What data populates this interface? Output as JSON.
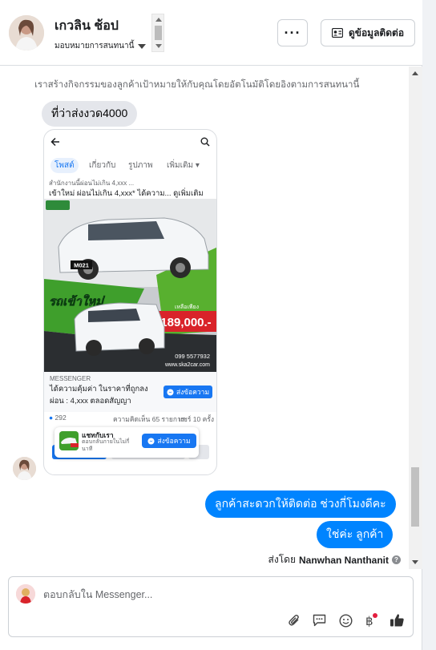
{
  "header": {
    "contact_name": "เกวลิน ช้อป",
    "assign_label": "มอบหมายการสนทนานี้",
    "more_label": "···",
    "contact_info_label": "ดูข้อมูลติดต่อ"
  },
  "conversation": {
    "system_note": "เราสร้างกิจกรรมของลูกค้าเป้าหมายให้กับคุณโดยอัตโนมัติโดยอิงตามการสนทนานี้",
    "incoming_message": "ที่ว่าส่งงวด4000",
    "outgoing_messages": [
      "ลูกค้าสะดวกให้ติดต่อ ช่วงกี่โมงดีคะ",
      "ใช่ค่ะ ลูกค้า"
    ],
    "sent_by_label": "ส่งโดย",
    "sent_by_name": "Nanwhan Nanthanit"
  },
  "ad_preview": {
    "tabs": [
      "โพสต์",
      "เกี่ยวกับ",
      "รูปภาพ",
      "เพิ่มเติม"
    ],
    "caption_top": "สำนักงานนี้ผ่อนไม่เกิน 4,xxx ...",
    "caption": "เข้าใหม่ ผ่อนไม่เกิน 4,xxx* ได้ความ... ดูเพิ่มเติม",
    "image_badge": "M021",
    "image_slogan": "รถเข้าใหม่",
    "price_label": "เหลือเพียง",
    "price": "189,000.-",
    "phone": "099 5577932",
    "website": "www.ska2car.com",
    "messenger_label": "MESSENGER",
    "messenger_text": "ได้ความคุ้มค่า ในราคาที่ถูกลง ผ่อน : 4,xxx ตลอดสัญญา",
    "send_button": "ส่งข้อความ",
    "reactions_count": "292",
    "comments": "ความคิดเห็น 65 รายการ",
    "shares": "แชร์ 10 ครั้ง",
    "popup_title": "แชทกับเรา",
    "popup_subtitle": "ตอบกลับภายในไม่กี่นาที",
    "popup_button": "ส่งข้อความ"
  },
  "composer": {
    "placeholder": "ตอบกลับใน Messenger..."
  },
  "colors": {
    "accent": "#0084ff",
    "incoming_bubble": "#e4e6eb",
    "price_red": "#d9232a"
  }
}
